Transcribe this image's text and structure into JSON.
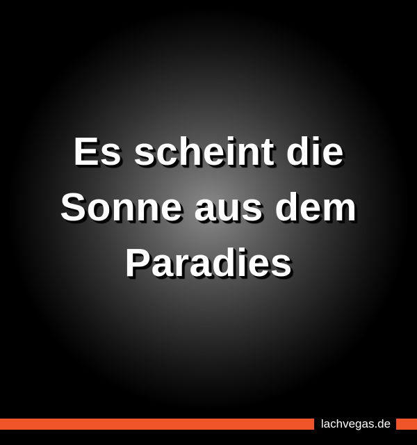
{
  "quote": {
    "lines": [
      "Es scheint die",
      "Sonne aus dem",
      "Paradies"
    ]
  },
  "footer": {
    "brand": "lachvegas.de",
    "accent_color": "#f0552a"
  }
}
